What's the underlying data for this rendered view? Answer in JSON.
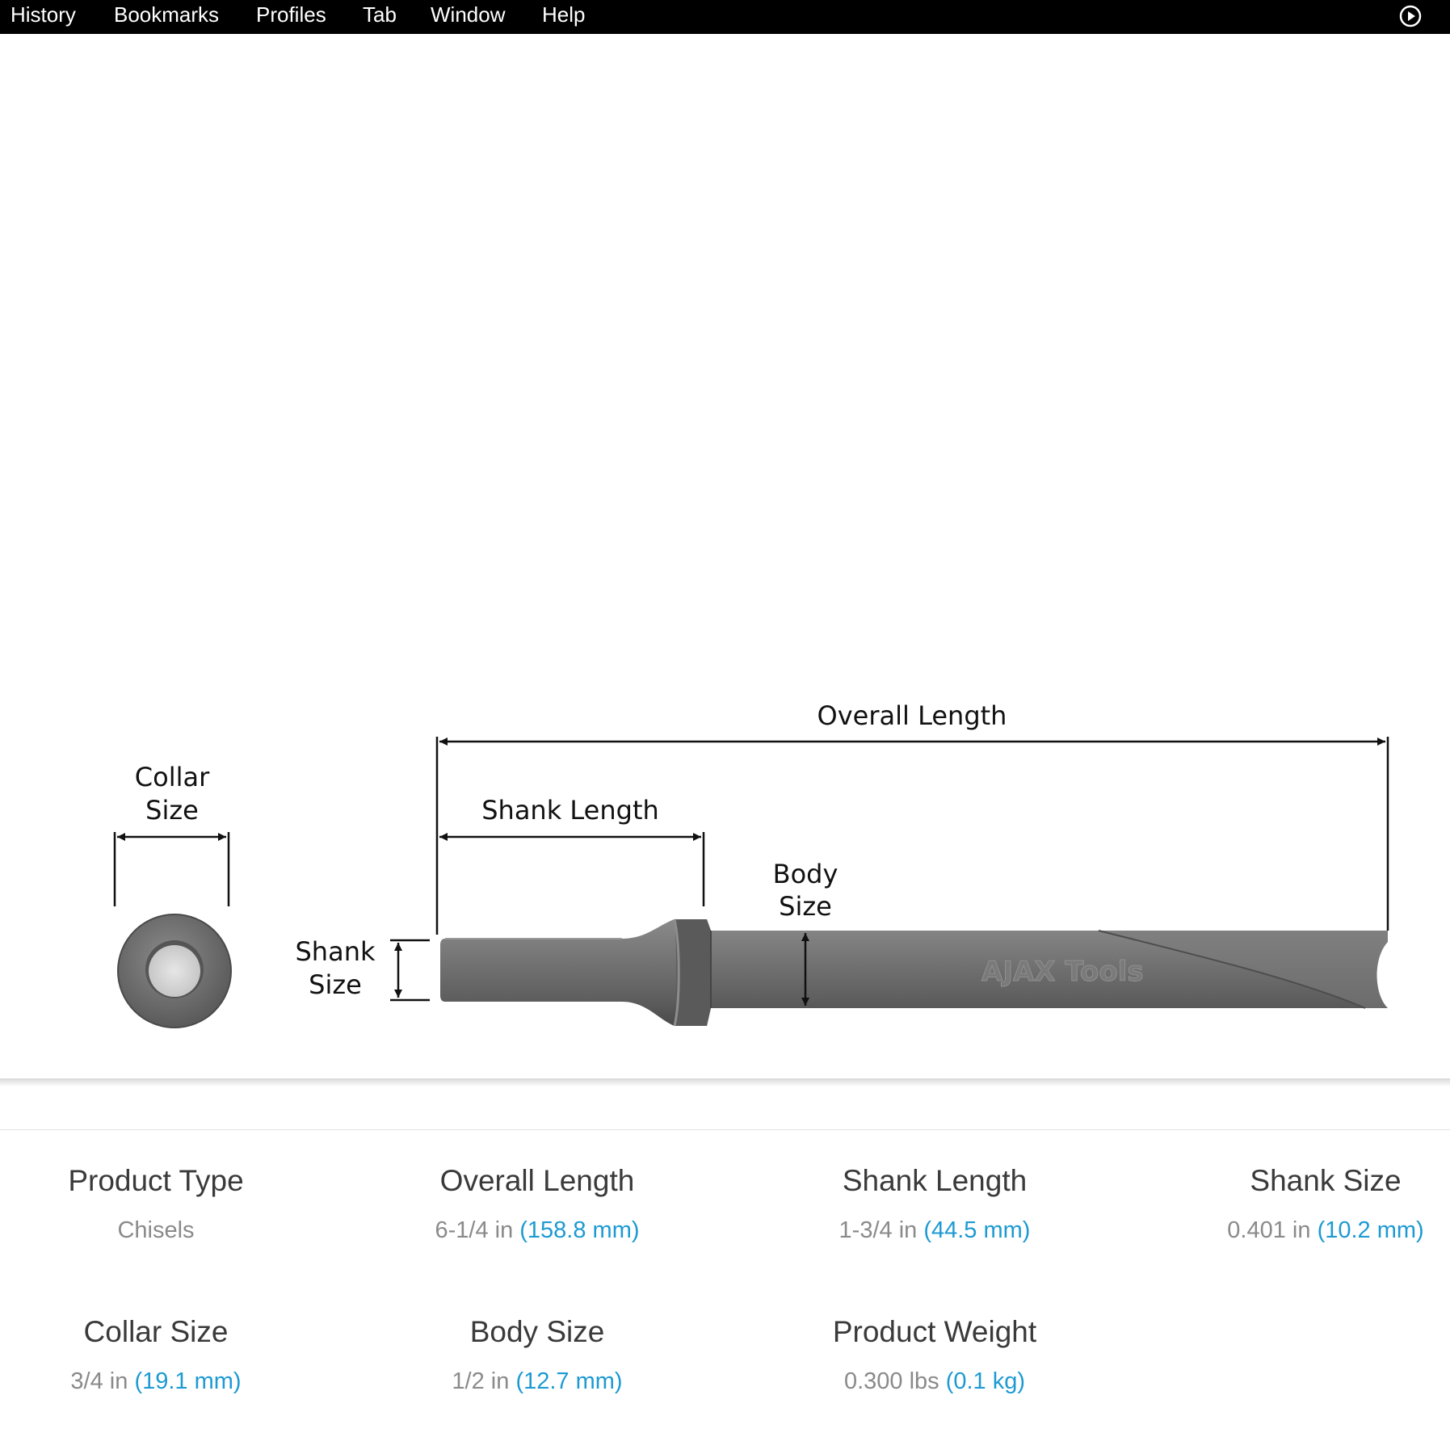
{
  "menubar": {
    "items": [
      "History",
      "Bookmarks",
      "Profiles",
      "Tab",
      "Window",
      "Help"
    ]
  },
  "diagram": {
    "labels": {
      "collar_line1": "Collar",
      "collar_line2": "Size",
      "overall": "Overall Length",
      "shank_length": "Shank Length",
      "body_line1": "Body",
      "body_line2": "Size",
      "shank_line1": "Shank",
      "shank_line2": "Size"
    },
    "logo_text": "AJAX Tools"
  },
  "specs": [
    {
      "label": "Product Type",
      "imperial": "Chisels",
      "metric": ""
    },
    {
      "label": "Overall Length",
      "imperial": "6-1/4 in",
      "metric": "(158.8 mm)"
    },
    {
      "label": "Shank Length",
      "imperial": "1-3/4 in",
      "metric": "(44.5 mm)"
    },
    {
      "label": "Shank Size",
      "imperial": "0.401 in",
      "metric": "(10.2 mm)"
    },
    {
      "label": "Collar Size",
      "imperial": "3/4 in",
      "metric": "(19.1 mm)"
    },
    {
      "label": "Body Size",
      "imperial": "1/2 in",
      "metric": "(12.7 mm)"
    },
    {
      "label": "Product Weight",
      "imperial": "0.300 lbs",
      "metric": "(0.1 kg)"
    }
  ],
  "colors": {
    "menubar_bg": "#000000",
    "metric_value": "#1d9ad2",
    "imperial_value": "#8a8a8a",
    "tool_metal": "#6b6b6b"
  }
}
